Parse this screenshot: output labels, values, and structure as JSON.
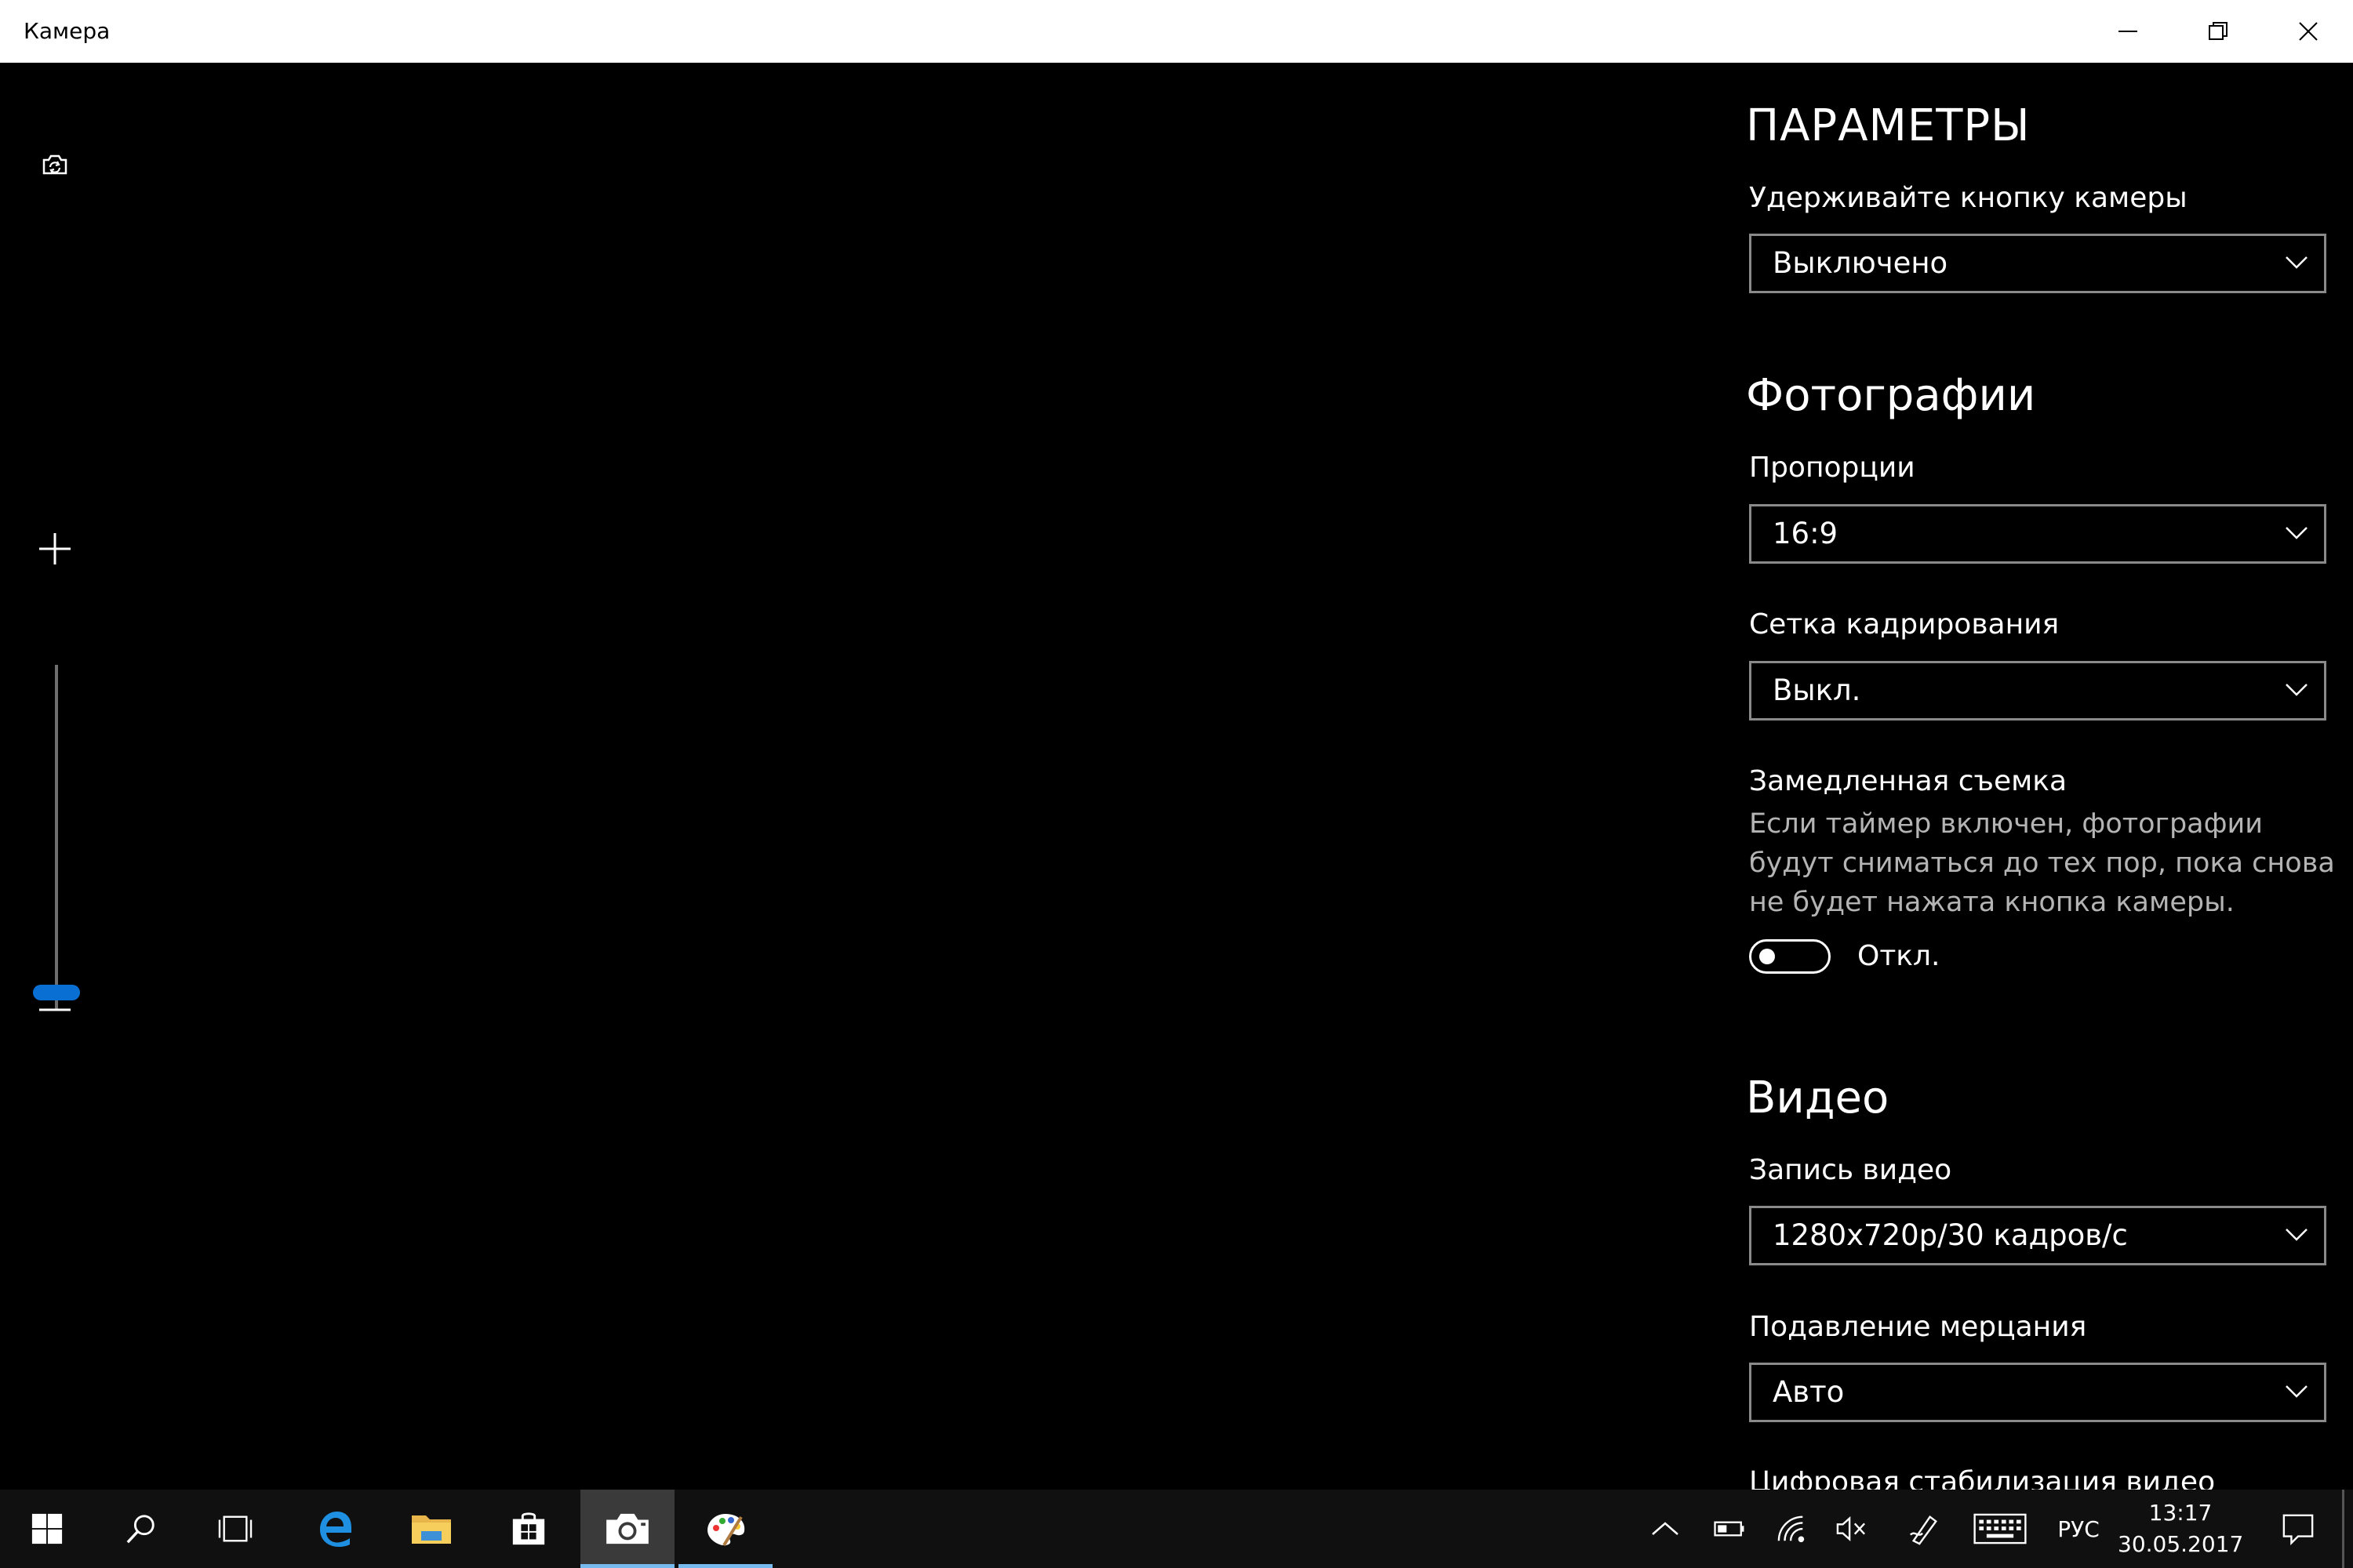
{
  "window": {
    "title": "Камера",
    "minimize_icon": "minimize-icon",
    "restore_icon": "restore-icon",
    "close_icon": "close-icon"
  },
  "camera": {
    "mode_icon": "camera-swap-icon",
    "zoom_in_icon": "plus-icon",
    "zoom_out_icon": "minus-icon",
    "zoom_level": 0.05
  },
  "settings": {
    "title": "ПАРАМЕТРЫ",
    "hold_button": {
      "label": "Удерживайте кнопку камеры",
      "value": "Выключено"
    },
    "photos": {
      "heading": "Фотографии",
      "aspect": {
        "label": "Пропорции",
        "value": "16:9"
      },
      "grid": {
        "label": "Сетка кадрирования",
        "value": "Выкл."
      },
      "timelapse": {
        "label": "Замедленная съемка",
        "description": "Если таймер включен, фотографии будут сниматься до тех пор, пока снова не будет нажата кнопка камеры.",
        "toggle_label": "Откл.",
        "enabled": false
      }
    },
    "video": {
      "heading": "Видео",
      "recording": {
        "label": "Запись видео",
        "value": "1280x720p/30 кадров/с"
      },
      "flicker": {
        "label": "Подавление мерцания",
        "value": "Авто"
      },
      "stabilization_label": "Цифровая стабилизация видео"
    }
  },
  "taskbar": {
    "items": [
      "windows-start-icon",
      "search-icon",
      "task-view-icon",
      "edge-icon",
      "file-explorer-icon",
      "store-icon",
      "camera-app-icon",
      "paint-app-icon"
    ],
    "tray": [
      "chevron-up-icon",
      "battery-icon",
      "wifi-icon",
      "volume-mute-icon",
      "pen-icon",
      "keyboard-icon"
    ],
    "language": "РУС",
    "time": "13:17",
    "date": "30.05.2017",
    "notifications_icon": "action-center-icon"
  }
}
